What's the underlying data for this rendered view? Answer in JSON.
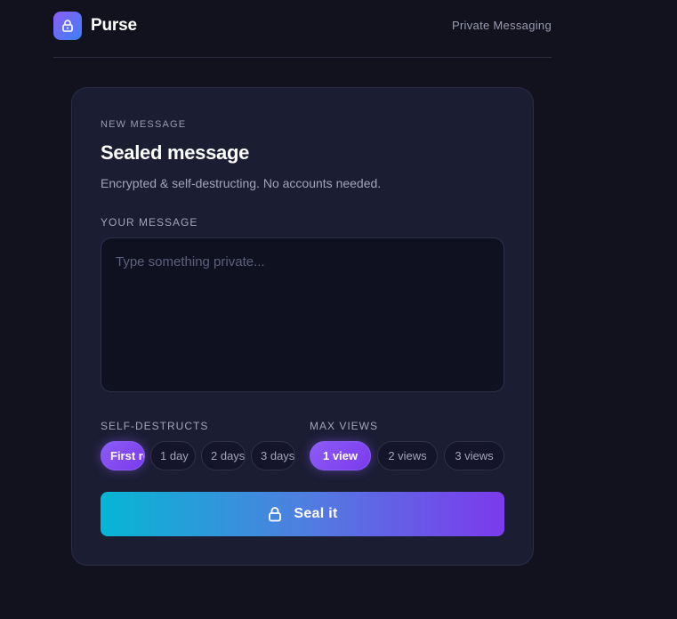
{
  "header": {
    "brand": "Purse",
    "tagline": "Private Messaging"
  },
  "card": {
    "eyebrow": "NEW MESSAGE",
    "title": "Sealed message",
    "subtitle": "Encrypted & self-destructing. No accounts needed.",
    "message_label": "YOUR MESSAGE",
    "message_value": "",
    "message_placeholder": "Type something private...",
    "destruct_label": "SELF-DESTRUCTS",
    "destruct_options": [
      "First read",
      "1 day",
      "2 days",
      "3 days"
    ],
    "destruct_selected": "First read",
    "views_label": "MAX VIEWS",
    "views_options": [
      "1 view",
      "2 views",
      "3 views"
    ],
    "views_selected": "1 view",
    "submit_label": "Seal it"
  },
  "colors": {
    "accent_purple": "#8b5cf6",
    "button_gradient_start": "#06b6d4",
    "button_gradient_end": "#7c3aed",
    "background": "#12121f",
    "card": "#1b1d33"
  },
  "icons": {
    "logo": "lock-icon",
    "submit": "lock-icon"
  }
}
